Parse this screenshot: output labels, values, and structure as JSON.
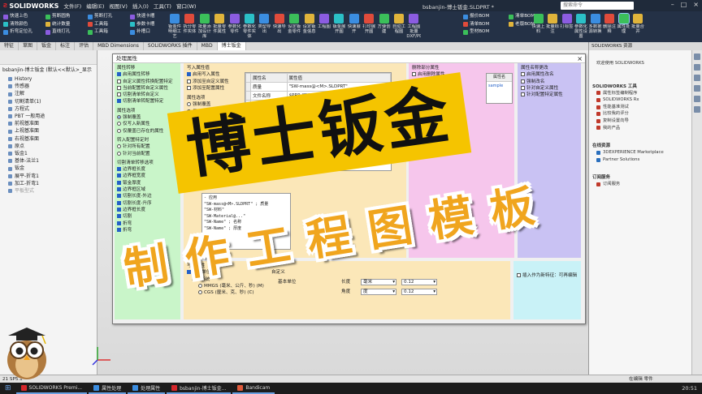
{
  "app": {
    "logo": "SOLIDWORKS",
    "menus": [
      "文件(F)",
      "编辑(E)",
      "视图(V)",
      "插入(I)",
      "工具(T)",
      "窗口(W)"
    ],
    "doc_title": "bsbanjin-博士钣金.SLDPRT *",
    "search_placeholder": "搜索命令"
  },
  "ribbon": {
    "col1": [
      "快速上色",
      "清除颜色",
      "折弯定位孔"
    ],
    "col2": [
      "剪断圆角",
      "统计数量",
      "直线打孔"
    ],
    "col3": [
      "剪断打孔",
      "工具箱",
      "工具箱"
    ],
    "col4": [
      "快速卡槽",
      "参数卡槽",
      "补槽口"
    ],
    "buttons": [
      "钣金件明细工艺",
      "拆分零件实体",
      "批量添加设计库",
      "批量零件属性",
      "参数化零件",
      "参数化零件实体",
      "类型导出",
      "快速导出",
      "设定钣金零件",
      "设定钣金信息",
      "工程图",
      "钣金展开图",
      "快速展开",
      "打印展开图",
      "方便创建",
      "自动工程图",
      "工程图批量DXF/PDF/DWG..."
    ],
    "col_right1": [
      "报价BOM",
      "清单BOM",
      "型材BOM"
    ],
    "col_right2": [
      "清单BOM",
      "老版BOM"
    ],
    "buttons_right": [
      "快速上料",
      "批量标注",
      "打标签",
      "参数化属性设置",
      "多数据源转换",
      "删除注释",
      "属性处理",
      "批量合并"
    ]
  },
  "tabs": [
    "特征",
    "草图",
    "钣金",
    "标注",
    "评估",
    "MBD Dimensions",
    "SOLIDWORKS 插件",
    "MBD",
    "博士钣金"
  ],
  "active_tab": "博士钣金",
  "feature_tree": {
    "root": "bsbanjin-博士钣金 (默认<<默认>_显示",
    "items": [
      "History",
      "传感器",
      "注解",
      "切割清单(1)",
      "方程式",
      "PBT 一般用途",
      "前视基准面",
      "上视基准面",
      "右视基准面",
      "原点",
      "钣金1",
      "基体-法兰1",
      "钣金",
      "展平-折弯1",
      "加工-折弯1",
      "平板型式"
    ]
  },
  "dialog": {
    "title": "处理属性",
    "close": "×",
    "p1": {
      "header": "属性转移",
      "items": [
        {
          "label": "启用属性转移",
          "checked": true
        },
        {
          "label": "自定义属性转换配置特定",
          "checked": false
        },
        {
          "label": "当前配置转自定义属性",
          "checked": false
        },
        {
          "label": "切割清单转自定义",
          "checked": false
        },
        {
          "label": "切割清单转配置特定",
          "checked": true
        }
      ],
      "option_header": "属性选项",
      "options": [
        {
          "label": "强制覆盖",
          "on": true
        },
        {
          "label": "仅写入新属性",
          "on": false
        },
        {
          "label": "仅覆盖已存在的属性",
          "on": false
        }
      ],
      "convert_header": "转入配置特定时",
      "convert": [
        {
          "label": "针对所有配置",
          "on": false
        },
        {
          "label": "针对当前配置",
          "on": false
        }
      ],
      "cut_header": "切割清单转移选项",
      "cut_items": [
        "边界框长度",
        "边界框宽度",
        "钣金厚度",
        "边界框区域",
        "切割长度-外边",
        "切割长度-升序",
        "边界框长度",
        "切割",
        "折弯",
        "折弯"
      ]
    },
    "p2": {
      "header": "写入属性值",
      "items": [
        {
          "label": "启用写入属性",
          "checked": true
        },
        {
          "label": "添加至自定义属性",
          "checked": false
        },
        {
          "label": "添加至配置属性",
          "checked": false
        }
      ],
      "option_header": "属性选项",
      "options": [
        {
          "label": "强制覆盖",
          "on": false
        },
        {
          "label": "仅写入新属性",
          "on": false
        },
        {
          "label": "仅覆盖已存在",
          "on": false
        }
      ],
      "code_lines": [
        "- 应用",
        "\"SW-mass@<M>.SLDPRT\" ; 质量",
        "\"SW-材料\"",
        "\"SW-Material@...\"",
        "\"SW-Name\" ; 名称",
        "\"SW-Name\" ; 厚度"
      ]
    },
    "table": {
      "headers": [
        "属性名",
        "属性值"
      ],
      "rows": [
        [
          "质量",
          "\"SW-mass@<M>.SLDPRT\""
        ],
        [
          "文件名称",
          "$PRP:\"SW-File Name\""
        ],
        [
          "材料",
          "\"SW-Material@...\""
        ],
        [
          "厚度",
          "\"厚度@<M>...\""
        ],
        [
          "表面积",
          ""
        ]
      ]
    },
    "p3": {
      "header": "删除部分属性",
      "items": [
        {
          "label": "启用删除属性",
          "checked": false
        },
        {
          "label": "删除自定义属性选项",
          "checked": false
        },
        {
          "label": "删除配置属性",
          "checked": false
        }
      ]
    },
    "small_table": {
      "header": "属性名",
      "value": "sample"
    },
    "p4": {
      "header": "属性名称更改",
      "items": [
        {
          "label": "启用属性改名",
          "checked": false
        },
        {
          "label": "强制改名",
          "checked": false
        },
        {
          "label": "针对自定义属性",
          "checked": false
        },
        {
          "label": "针对配置特定属性",
          "checked": false
        }
      ]
    },
    "p5": {
      "header": "写入属性",
      "units_label": "更改单位",
      "unit_system": "单位系统",
      "unit_options": [
        {
          "label": "MMGS (毫米、公斤、秒) (M)",
          "on": false
        },
        {
          "label": "CGS (厘米、克、秒) (C)",
          "on": false
        }
      ],
      "custom_label": "自定义",
      "base_unit": "基本单位",
      "length_label": "长度",
      "length_value": "毫米",
      "angle_label": "角度",
      "angle_value": "度",
      "decimals1": "0.12",
      "decimals2": "0.12"
    },
    "insert_label": "插入作为新特征：可再编辑"
  },
  "overlay": {
    "title1": "博士钣金",
    "title2": "制作工程图模板"
  },
  "task_pane": {
    "header": "SOLIDWORKS 资源",
    "welcome": "欢迎使用 SOLIDWORKS",
    "sections": [
      {
        "title": "SOLIDWORKS 工具",
        "items": [
          "属性标签编制程序",
          "SOLIDWORKS Rx",
          "性能基准测试",
          "比较我的评分",
          "复制设置向导",
          "我的产品"
        ]
      },
      {
        "title": "在线资源",
        "items": [
          "3DEXPERIENCE Marketplace",
          "Partner Solutions"
        ]
      },
      {
        "title": "订阅服务",
        "items": [
          "订阅服务"
        ]
      }
    ]
  },
  "status": {
    "left": "21 SP5.1",
    "right": "在编辑 零件"
  },
  "taskbar": {
    "items": [
      "SOLIDWORKS Premi...",
      "属性处理",
      "处理属性",
      "bsbanjin-博士钣金...",
      "Bandicam"
    ],
    "clock": "20:51"
  },
  "colors": {
    "pane1": "#c9f5c9",
    "pane2": "#fbe7b8",
    "pane3": "#f6c6ec",
    "pane4": "#c9c2f3",
    "pane5": "#fbe7b8",
    "pane6": "#c9f2f7",
    "title1_bg": "#f5c400",
    "title2": "#f0a51e"
  }
}
